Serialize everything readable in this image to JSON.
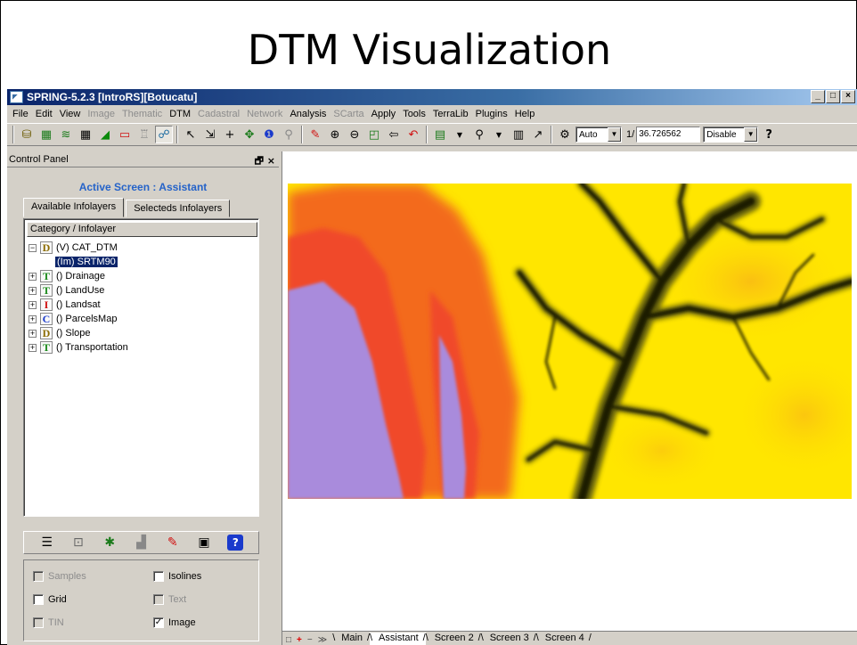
{
  "slide": {
    "title": "DTM Visualization"
  },
  "window": {
    "title": "SPRING-5.2.3 [IntroRS][Botucatu]",
    "controls": [
      "_",
      "□",
      "×"
    ]
  },
  "menu": [
    {
      "label": "File",
      "enabled": true
    },
    {
      "label": "Edit",
      "enabled": true
    },
    {
      "label": "View",
      "enabled": true
    },
    {
      "label": "Image",
      "enabled": false
    },
    {
      "label": "Thematic",
      "enabled": false
    },
    {
      "label": "DTM",
      "enabled": true
    },
    {
      "label": "Cadastral",
      "enabled": false
    },
    {
      "label": "Network",
      "enabled": false
    },
    {
      "label": "Analysis",
      "enabled": true
    },
    {
      "label": "SCarta",
      "enabled": false
    },
    {
      "label": "Apply",
      "enabled": true
    },
    {
      "label": "Tools",
      "enabled": true
    },
    {
      "label": "TerraLib",
      "enabled": true
    },
    {
      "label": "Plugins",
      "enabled": true
    },
    {
      "label": "Help",
      "enabled": true
    }
  ],
  "toolbar": {
    "auto_combo": "Auto",
    "scale_prefix": "1/",
    "scale_value": "36.726562",
    "disable_combo": "Disable"
  },
  "control_panel": {
    "title": "Control Panel",
    "header_controls": "🗗 ×",
    "active_screen": "Active Screen : Assistant",
    "tabs": [
      "Available Infolayers",
      "Selecteds Infolayers"
    ],
    "tree_header": "Category / Infolayer",
    "tree": [
      {
        "expander": "−",
        "badge": "D",
        "badge_color": "#8b6b00",
        "label": "(V) CAT_DTM"
      },
      {
        "child": true,
        "label": "(Im) SRTM90"
      },
      {
        "expander": "+",
        "badge": "T",
        "badge_color": "#1a8a1a",
        "label": "() Drainage"
      },
      {
        "expander": "+",
        "badge": "T",
        "badge_color": "#1a8a1a",
        "label": "() LandUse"
      },
      {
        "expander": "+",
        "badge": "I",
        "badge_color": "#d01010",
        "label": "() Landsat"
      },
      {
        "expander": "+",
        "badge": "C",
        "badge_color": "#1a3acc",
        "label": "() ParcelsMap"
      },
      {
        "expander": "+",
        "badge": "D",
        "badge_color": "#8b6b00",
        "label": "() Slope"
      },
      {
        "expander": "+",
        "badge": "T",
        "badge_color": "#1a8a1a",
        "label": "() Transportation"
      }
    ],
    "options": {
      "samples": "Samples",
      "isolines": "Isolines",
      "grid": "Grid",
      "text": "Text",
      "tin": "TIN",
      "image": "Image",
      "image_checked": "✓"
    }
  },
  "screen_tabs": {
    "controls": [
      "□",
      "+",
      "−",
      "≫"
    ],
    "tabs": [
      "Main",
      "Assistant",
      "Screen 2",
      "Screen 3",
      "Screen 4"
    ],
    "active": "Assistant"
  },
  "colors": {
    "accent": "#2563c9",
    "dtm_low": "#a98bdc",
    "dtm_mid_low": "#f05a28",
    "dtm_mid": "#ffe600",
    "dtm_high": "#1e1e05"
  }
}
